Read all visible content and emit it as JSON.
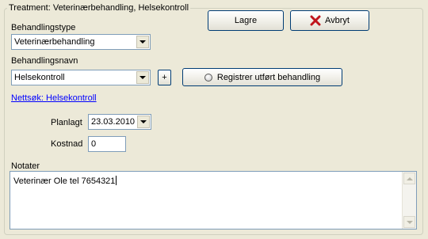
{
  "group": {
    "title": "Treatment: Veterinærbehandling, Helsekontroll"
  },
  "treatment_type": {
    "label": "Behandlingstype",
    "value": "Veterinærbehandling"
  },
  "treatment_name": {
    "label": "Behandlingsnavn",
    "value": "Helsekontroll"
  },
  "add_button": {
    "label": "+"
  },
  "register_button": {
    "label": "Registrer utført behandling"
  },
  "web_search_link": {
    "text": "Nettsøk: Helsekontroll"
  },
  "planned": {
    "label": "Planlagt",
    "value": "23.03.2010"
  },
  "cost": {
    "label": "Kostnad",
    "value": "0"
  },
  "notes": {
    "label": "Notater",
    "value": "Veterinær Ole tel 7654321"
  },
  "save_button": {
    "label": "Lagre"
  },
  "cancel_button": {
    "label": "Avbryt",
    "icon": "red-x-icon",
    "icon_color": "#c0141c"
  }
}
